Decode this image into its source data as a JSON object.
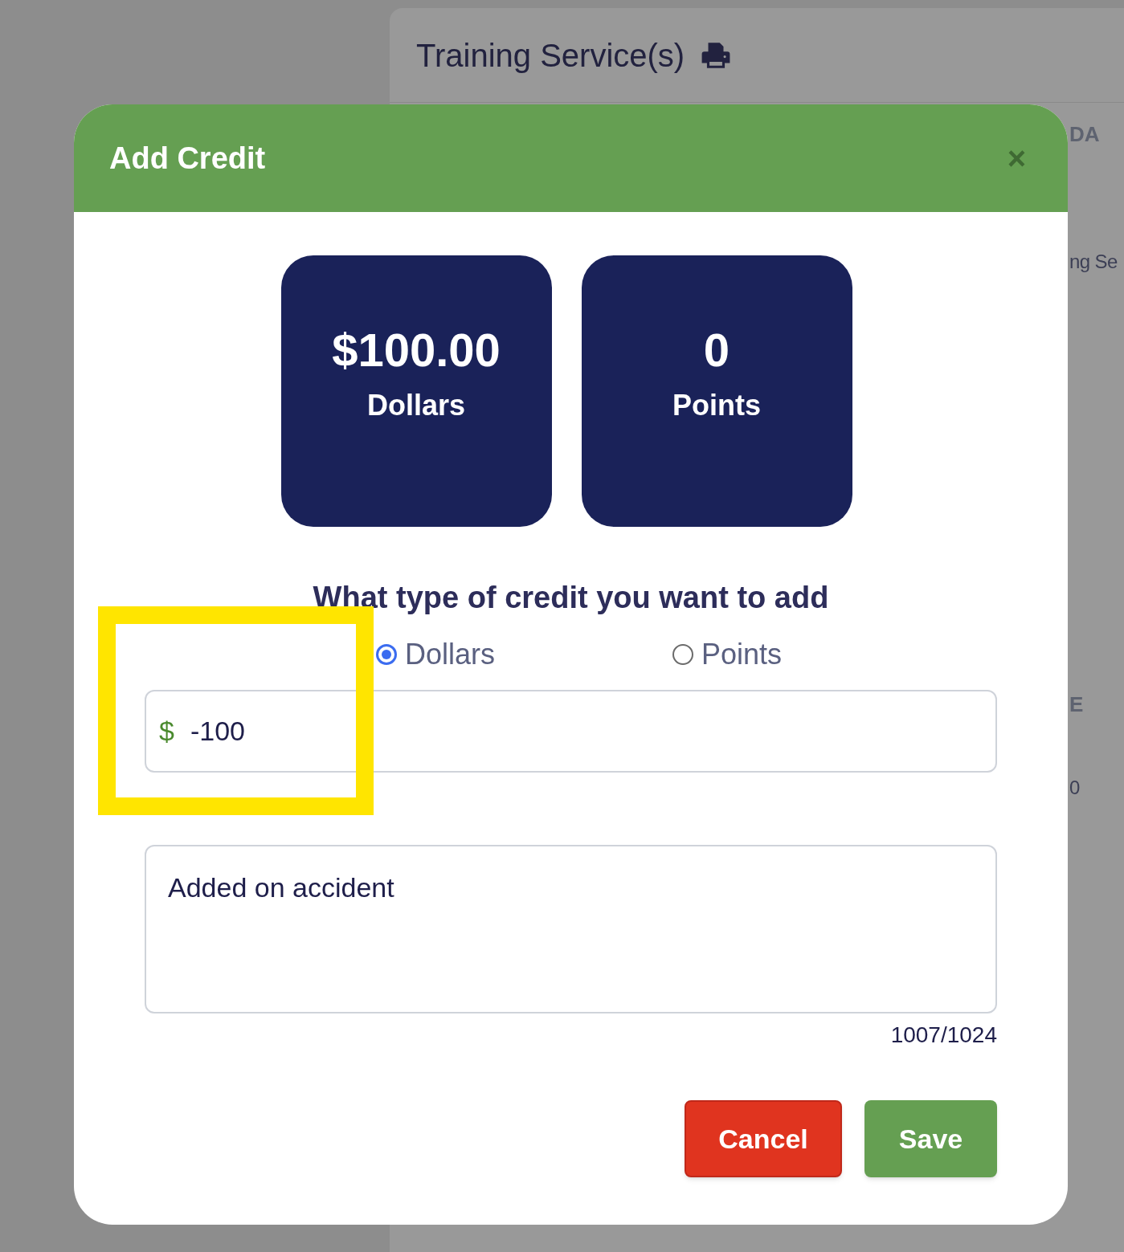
{
  "background": {
    "title": "Training Service(s)",
    "fragments": [
      {
        "text": "DA",
        "kind": "header"
      },
      {
        "text": "ng Se",
        "kind": "cell"
      },
      {
        "text": "E",
        "kind": "header"
      },
      {
        "text": "0",
        "kind": "cell"
      }
    ]
  },
  "dialog": {
    "title": "Add Credit",
    "close": "×",
    "balances": [
      {
        "value": "$100.00",
        "label": "Dollars"
      },
      {
        "value": "0",
        "label": "Points"
      }
    ],
    "question": "What type of credit you want to add",
    "options": [
      {
        "label": "Dollars",
        "selected": true
      },
      {
        "label": "Points",
        "selected": false
      }
    ],
    "amount": {
      "prefix": "$",
      "value": "-100"
    },
    "notes": {
      "value": "Added on accident",
      "counter": "1007/1024"
    },
    "buttons": [
      {
        "label": "Cancel",
        "kind": "cancel"
      },
      {
        "label": "Save",
        "kind": "save"
      }
    ]
  },
  "highlight": true
}
